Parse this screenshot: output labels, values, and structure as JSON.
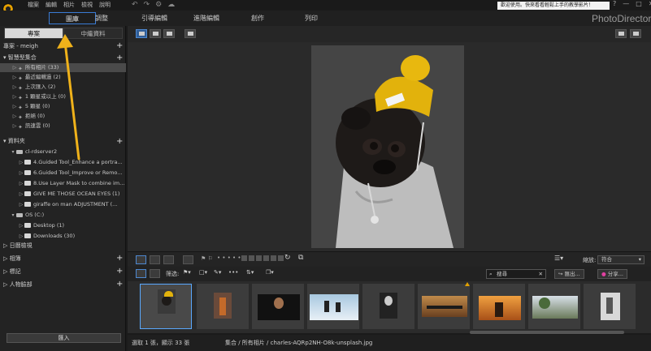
{
  "menu": [
    "檔案",
    "編輯",
    "相片",
    "檢視",
    "說明"
  ],
  "notice": "歡迎使用。快來看看輕鬆上手的教學影片！",
  "window_buttons": [
    "?",
    "—",
    "□",
    "✕"
  ],
  "modules": [
    {
      "label": "圖庫",
      "active": true
    },
    {
      "label": "調整",
      "active": false
    },
    {
      "label": "引導編輯",
      "active": false
    },
    {
      "label": "進階編輯",
      "active": false
    },
    {
      "label": "創作",
      "active": false
    },
    {
      "label": "列印",
      "active": false
    }
  ],
  "brand": "PhotoDirector",
  "left_tabs": [
    "專案",
    "中繼資料"
  ],
  "project_label": "專案 - meigh",
  "smart_collection": {
    "title": "智慧型集合",
    "items": [
      "所有相片 (33)",
      "最近編輯過 (2)",
      "上次匯入 (2)",
      "1 顆星或以上 (0)",
      "5 顆星 (0)",
      "拒絕 (0)",
      "訊連雲 (0)"
    ]
  },
  "folders": {
    "title": "資料夾",
    "server": "cl-rdserver2",
    "server_items": [
      "4.Guided Tool_Enhance a portra...",
      "6.Guided Tool_Improve or Remo...",
      "8.Use Layer Mask to combine im...",
      "GIVE ME THOSE OCEAN EYES (1)",
      "giraffe on man ADJUSTMENT (..."
    ],
    "drive": "OS (C:)",
    "drive_items": [
      "Desktop (1)",
      "Downloads (30)"
    ]
  },
  "sections": [
    "日曆檢視",
    "相簿",
    "標記",
    "人物臉部"
  ],
  "import_button": "匯入",
  "filter_label": "筛选:",
  "zoom_label": "縮放:",
  "zoom_value": "符合",
  "search_placeholder": "搜尋",
  "export_button": "匯出...",
  "share_button": "分享...",
  "status": {
    "selection": "選取 1 張，顯示 33 張",
    "path": "集合 / 所有相片 / charles-AQRp2NH-O8k-unsplash.jpg"
  },
  "thumbnails": [
    {
      "name": "pug-yellow-hat",
      "active": true
    },
    {
      "name": "wooden-bottle",
      "active": false
    },
    {
      "name": "man-portrait",
      "active": false
    },
    {
      "name": "penguins-beach",
      "active": false
    },
    {
      "name": "bw-portrait",
      "active": false
    },
    {
      "name": "camels-sunset",
      "active": false
    },
    {
      "name": "couple-sunset",
      "active": false
    },
    {
      "name": "giraffes-trees",
      "active": false
    },
    {
      "name": "woman-bw",
      "active": false
    }
  ],
  "colors": {
    "accent": "#3a7bd5",
    "arrow": "#f0b21a",
    "hat": "#e2b20c"
  }
}
